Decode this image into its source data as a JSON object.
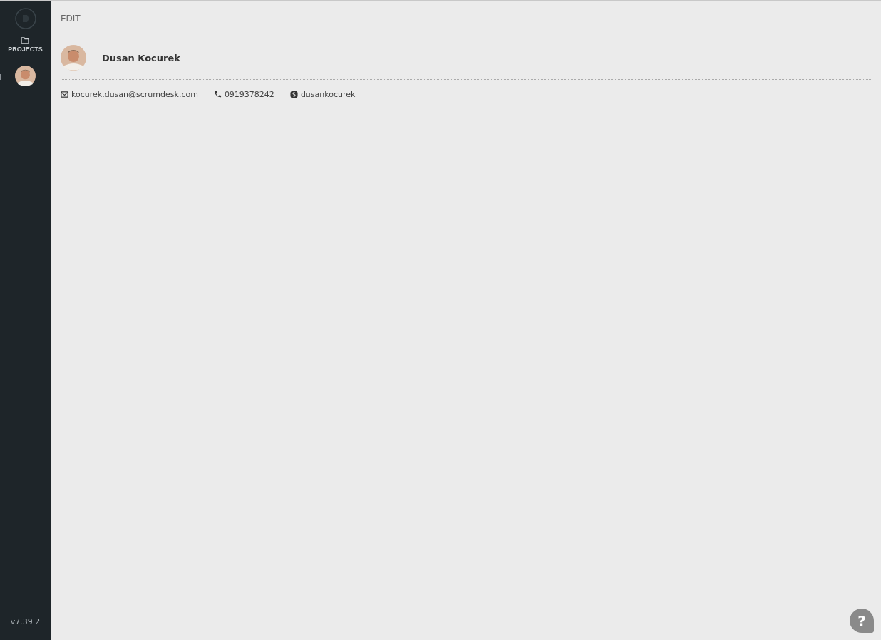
{
  "sidebar": {
    "items": [
      {
        "kind": "nav",
        "label": "PROJECTS",
        "selected": false
      },
      {
        "kind": "avatar",
        "selected": true
      }
    ],
    "version": "v7.39.2"
  },
  "toolbar": {
    "buttons": [
      "EDIT"
    ]
  },
  "profile": {
    "name": "Dusan Kocurek",
    "contacts": [
      {
        "kind": "email",
        "text": "kocurek.dusan@scrumdesk.com"
      },
      {
        "kind": "phone",
        "text": "0919378242"
      },
      {
        "kind": "skype",
        "text": "dusankocurek"
      }
    ]
  },
  "help": {
    "label": "?"
  }
}
